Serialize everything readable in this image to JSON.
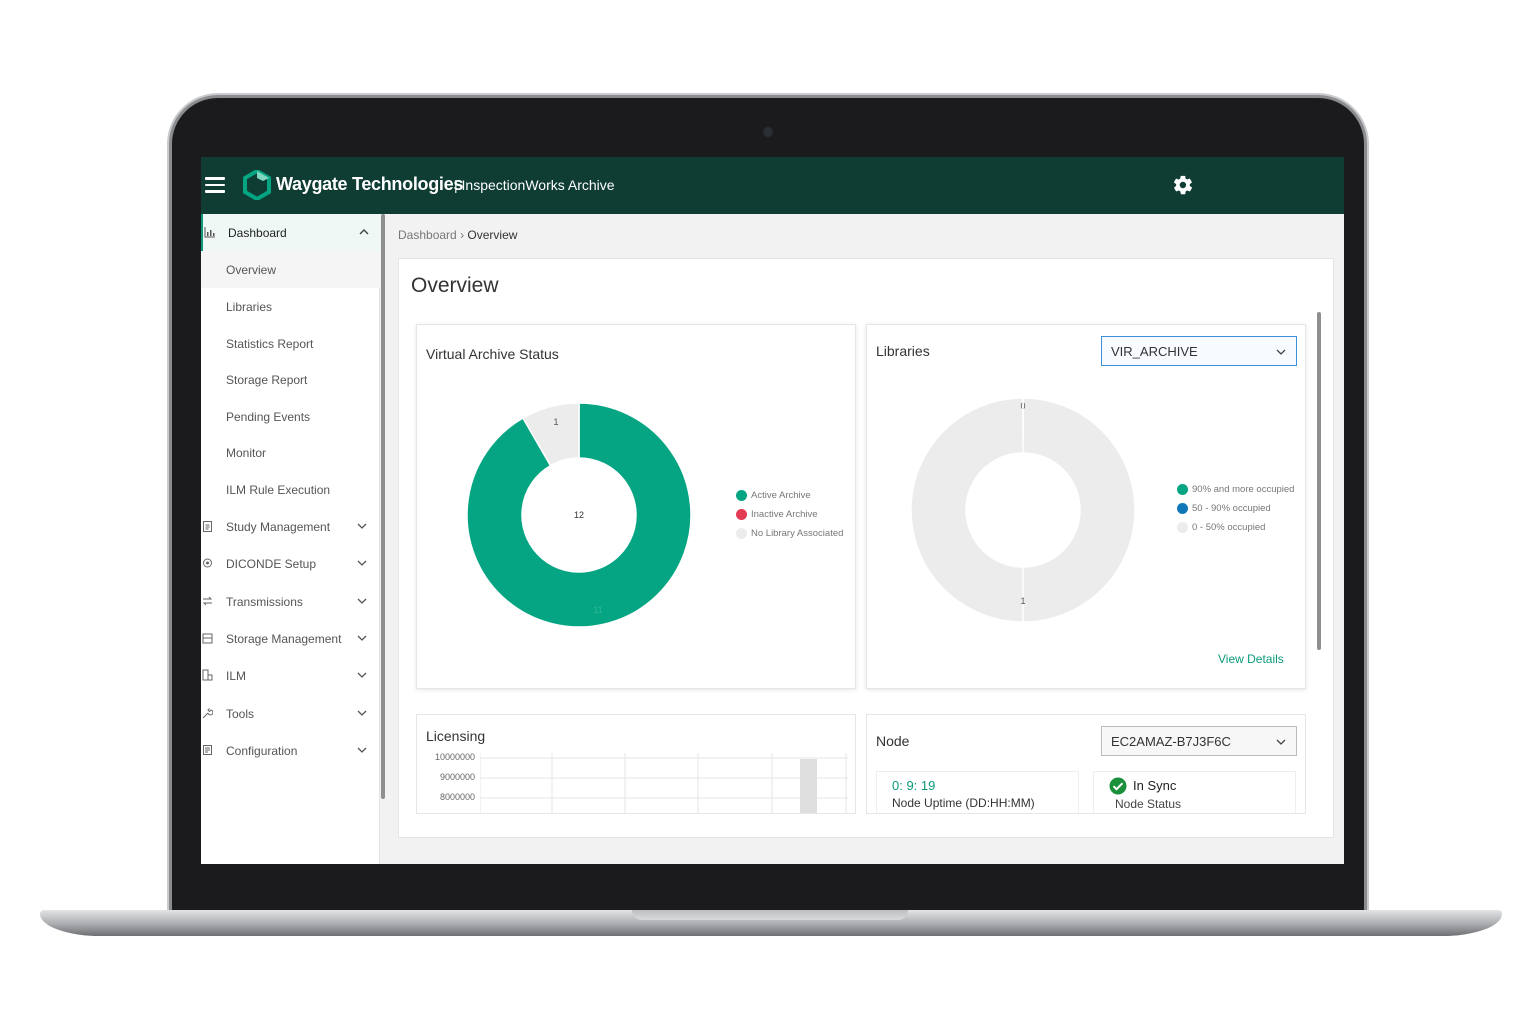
{
  "header": {
    "brand": "Waygate Technologies",
    "product": "| InspectionWorks Archive",
    "brand_color": "#0f3c33",
    "accent_color": "#0a9a7a"
  },
  "sidebar": {
    "dashboard": {
      "label": "Dashboard",
      "icon": "bar-chart-icon",
      "expanded": true
    },
    "sub_items": [
      {
        "label": "Overview",
        "active": true
      },
      {
        "label": "Libraries"
      },
      {
        "label": "Statistics Report"
      },
      {
        "label": "Storage Report"
      },
      {
        "label": "Pending Events"
      },
      {
        "label": "Monitor"
      },
      {
        "label": "ILM Rule Execution"
      }
    ],
    "groups": [
      {
        "label": "Study Management",
        "icon": "clipboard-icon"
      },
      {
        "label": "DICONDE Setup",
        "icon": "settings-icon"
      },
      {
        "label": "Transmissions",
        "icon": "transfer-icon"
      },
      {
        "label": "Storage Management",
        "icon": "storage-icon"
      },
      {
        "label": "ILM",
        "icon": "ilm-icon"
      },
      {
        "label": "Tools",
        "icon": "wrench-icon"
      },
      {
        "label": "Configuration",
        "icon": "config-icon"
      }
    ]
  },
  "breadcrumb": {
    "root": "Dashboard",
    "current": "Overview"
  },
  "page": {
    "title": "Overview"
  },
  "virtual_archive": {
    "title": "Virtual Archive Status",
    "center_label": "12",
    "legend": [
      "Active Archive",
      "Inactive Archive",
      "No Library Associated"
    ],
    "slice_labels": [
      "1",
      "0",
      "11"
    ],
    "colors": [
      "#05a583",
      "#e33b54",
      "#ececec"
    ]
  },
  "libraries": {
    "title": "Libraries",
    "selected": "VIR_ARCHIVE",
    "legend": [
      "90% and more occupied",
      "50 - 90% occupied",
      "0 - 50% occupied"
    ],
    "slice_labels": [
      "0",
      "1"
    ],
    "colors": [
      "#05a583",
      "#1077b8",
      "#ececec"
    ],
    "view_details": "View Details"
  },
  "licensing": {
    "title": "Licensing",
    "ticks": [
      "10000000",
      "9000000",
      "8000000"
    ]
  },
  "node": {
    "title": "Node",
    "selected": "EC2AMAZ-B7J3F6C",
    "uptime_value": "0: 9: 19",
    "uptime_label": "Node Uptime (DD:HH:MM)",
    "status_value": "In Sync",
    "status_label": "Node Status"
  },
  "chart_data": [
    {
      "type": "pie",
      "title": "Virtual Archive Status",
      "categories": [
        "Active Archive",
        "Inactive Archive",
        "No Library Associated"
      ],
      "values": [
        11,
        0,
        1
      ],
      "total": 12
    },
    {
      "type": "pie",
      "title": "Libraries",
      "categories": [
        "90% and more occupied",
        "50 - 90% occupied",
        "0 - 50% occupied"
      ],
      "values": [
        0,
        0,
        1
      ]
    }
  ]
}
